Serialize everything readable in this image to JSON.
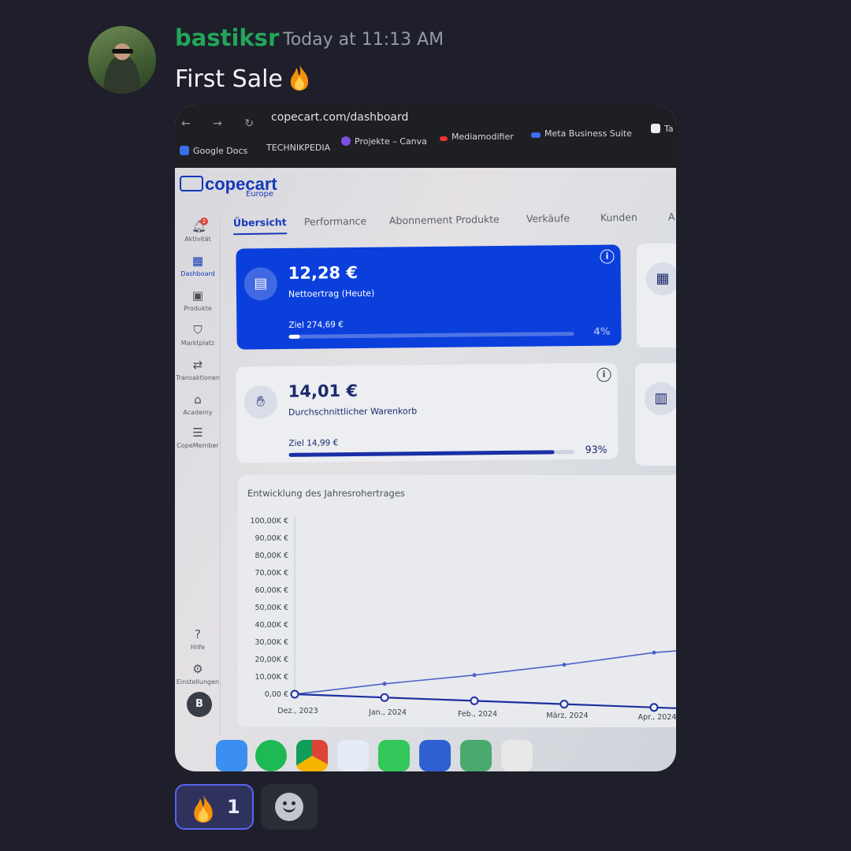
{
  "message": {
    "author": "bastiksr",
    "author_color": "#23a55a",
    "timestamp": "Today at 11:13 AM",
    "text": "First Sale",
    "emoji": "fire"
  },
  "reactions": [
    {
      "emoji": "fire",
      "count": "1",
      "reacted": true
    }
  ],
  "add_reaction_icon": "smile-plus-icon",
  "screenshot": {
    "url": "copecart.com/dashboard",
    "bookmarks": [
      "Google Docs",
      "TECHNIKPEDIA",
      "Projekte – Canva",
      "Mediamodifier",
      "Meta Business Suite",
      "Ta"
    ],
    "brand": {
      "name": "copecart",
      "sub": "Europe",
      "color": "#1638b8"
    },
    "sidebar": [
      {
        "label": "Aktivität",
        "icon": "bell-icon",
        "badge": "2"
      },
      {
        "label": "Dashboard",
        "icon": "grid-icon",
        "active": true
      },
      {
        "label": "Produkte",
        "icon": "box-icon"
      },
      {
        "label": "Marktplatz",
        "icon": "basket-icon"
      },
      {
        "label": "Transaktionen",
        "icon": "arrows-icon"
      },
      {
        "label": "Academy",
        "icon": "graduation-icon"
      },
      {
        "label": "CopeMember",
        "icon": "member-icon"
      },
      {
        "label": "Hilfe",
        "icon": "help-icon"
      },
      {
        "label": "Einstellungen",
        "icon": "gear-icon"
      }
    ],
    "user_initial": "B",
    "tabs": [
      "Übersicht",
      "Performance",
      "Abonnement Produkte",
      "Verkäufe",
      "Kunden",
      "A"
    ],
    "cards": {
      "net": {
        "value": "12,28 €",
        "label": "Nettoertrag (Heute)",
        "goal": "Ziel 274,69 €",
        "percent": "4%",
        "progress": 0.04,
        "color": "#0b3fdc"
      },
      "avg": {
        "value": "14,01 €",
        "label": "Durchschnittlicher Warenkorb",
        "goal": "Ziel 14,99 €",
        "percent": "93%",
        "progress": 0.93
      }
    },
    "chart_data": {
      "type": "line",
      "title": "Entwicklung des Jahresrohertrages",
      "ytick_labels": [
        "100,00K €",
        "90,00K €",
        "80,00K €",
        "70,00K €",
        "60,00K €",
        "50,00K €",
        "40,00K €",
        "30,00K €",
        "20,00K €",
        "10,00K €",
        "0,00 €"
      ],
      "ylim": [
        0,
        100000
      ],
      "categories": [
        "Dez., 2023",
        "Jan., 2024",
        "Feb., 2024",
        "März, 2024",
        "Apr., 2024"
      ],
      "series": [
        {
          "values": [
            0,
            6000,
            11000,
            17000,
            24000,
            28000
          ],
          "color": "#4a63c7"
        },
        {
          "values": [
            0,
            0,
            0,
            0,
            0,
            0
          ],
          "color": "#1d2f9e"
        }
      ]
    }
  }
}
